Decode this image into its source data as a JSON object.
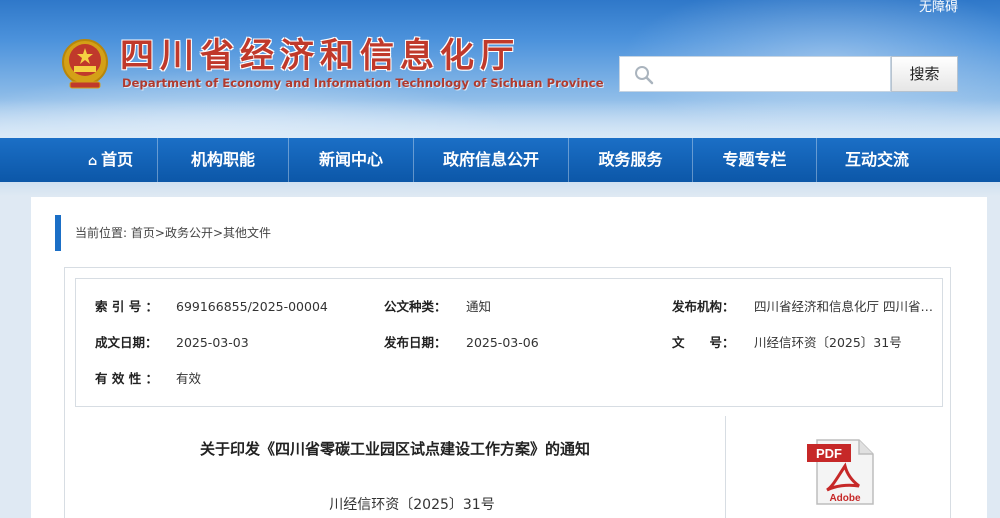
{
  "header": {
    "accessibility_label": "无障碍",
    "title_cn": "四川省经济和信息化厅",
    "title_en": "Department of Economy and Information Technology of Sichuan Province",
    "search_placeholder": "",
    "search_button": "搜索"
  },
  "nav": {
    "items": [
      {
        "label": "首页",
        "icon": "home-icon"
      },
      {
        "label": "机构职能"
      },
      {
        "label": "新闻中心"
      },
      {
        "label": "政府信息公开"
      },
      {
        "label": "政务服务"
      },
      {
        "label": "专题专栏"
      },
      {
        "label": "互动交流"
      }
    ]
  },
  "breadcrumb": {
    "prefix": "当前位置:",
    "items": [
      "首页",
      "政务公开",
      "其他文件"
    ],
    "separator": ">"
  },
  "meta": {
    "index_label": "索 引 号 ：",
    "index_value": "699166855/2025-00004",
    "category_label": "公文种类：",
    "category_value": "通知",
    "publisher_label": "发布机构：",
    "publisher_value": "四川省经济和信息化厅 四川省生…",
    "created_label": "成文日期：",
    "created_value": "2025-03-03",
    "published_label": "发布日期：",
    "published_value": "2025-03-06",
    "docno_label": "文　　号：",
    "docno_value": "川经信环资〔2025〕31号",
    "validity_label": "有 效 性 ：",
    "validity_value": "有效"
  },
  "article": {
    "title": "关于印发《四川省零碳工业园区试点建设工作方案》的通知",
    "doc_number": "川经信环资〔2025〕31号",
    "attachment_icon": "pdf-icon",
    "pdf_label": "PDF",
    "adobe_label": "Adobe"
  },
  "colors": {
    "nav_blue": "#1b6fc6",
    "title_red": "#c0392b",
    "page_bg": "#dfe9f3"
  }
}
